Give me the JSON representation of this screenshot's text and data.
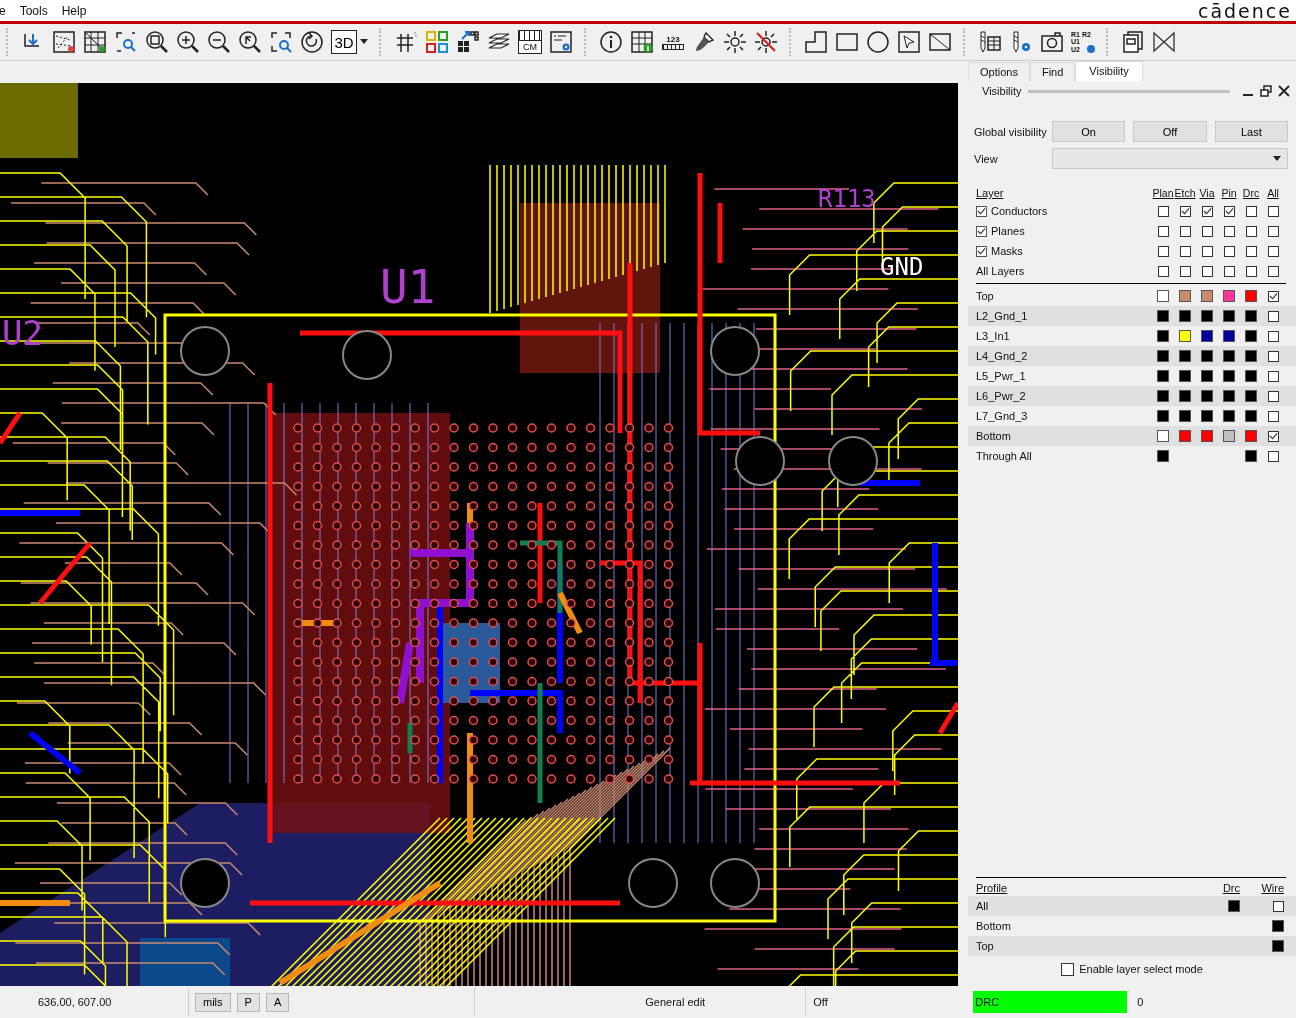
{
  "menu": [
    "e",
    "Tools",
    "Help"
  ],
  "logo": "cādence",
  "toolbar": {
    "button_3d": "3D",
    "cm_label": "CM",
    "ruler_label": "123",
    "refdes_lines": [
      "R1 R2",
      "U1",
      "U2"
    ]
  },
  "board_labels": [
    {
      "text": "U1",
      "kind": "ref"
    },
    {
      "text": "U2",
      "kind": "ref"
    },
    {
      "text": "R113",
      "kind": "ref"
    },
    {
      "text": "GND",
      "kind": "net"
    }
  ],
  "panel": {
    "tabs": [
      {
        "label": "Options",
        "selected": false
      },
      {
        "label": "Find",
        "selected": false
      },
      {
        "label": "Visibility",
        "selected": true
      }
    ],
    "title": "Visibility",
    "global_label": "Global visibility",
    "global_buttons": [
      "On",
      "Off",
      "Last"
    ],
    "view_label": "View",
    "layer_header": "Layer",
    "columns": [
      "Plan",
      "Etch",
      "Via",
      "Pin",
      "Drc",
      "All"
    ],
    "groups": [
      {
        "name": "Conductors",
        "kind": "check",
        "checked": true,
        "cells": [
          false,
          true,
          true,
          true,
          false,
          false
        ]
      },
      {
        "name": "Planes",
        "kind": "check",
        "checked": true,
        "cells": [
          false,
          false,
          false,
          false,
          false,
          false
        ]
      },
      {
        "name": "Masks",
        "kind": "check",
        "checked": true,
        "cells": [
          false,
          false,
          false,
          false,
          false,
          false
        ]
      },
      {
        "name": "All Layers",
        "kind": "plain",
        "cells": [
          false,
          false,
          false,
          false,
          false,
          false
        ]
      }
    ],
    "layers": [
      {
        "name": "Top",
        "swatches": [
          {
            "kind": "swatch",
            "color": "#ffffff"
          },
          {
            "kind": "swatch",
            "color": "#c8896e"
          },
          {
            "kind": "swatch",
            "color": "#c8896e"
          },
          {
            "kind": "swatch",
            "color": "#ff3399"
          },
          {
            "kind": "swatch",
            "color": "#ff0000"
          }
        ],
        "all": true
      },
      {
        "name": "L2_Gnd_1",
        "swatches": [
          {
            "kind": "swatch",
            "color": "#000000"
          },
          {
            "kind": "swatch",
            "color": "#000000"
          },
          {
            "kind": "swatch",
            "color": "#000000"
          },
          {
            "kind": "swatch",
            "color": "#000000"
          },
          {
            "kind": "swatch",
            "color": "#000000"
          }
        ],
        "all": false
      },
      {
        "name": "L3_In1",
        "swatches": [
          {
            "kind": "swatch",
            "color": "#000000"
          },
          {
            "kind": "swatch",
            "color": "#ffff00"
          },
          {
            "kind": "swatch",
            "color": "#000099"
          },
          {
            "kind": "swatch",
            "color": "#000099"
          },
          {
            "kind": "swatch",
            "color": "#000000"
          }
        ],
        "all": false
      },
      {
        "name": "L4_Gnd_2",
        "swatches": [
          {
            "kind": "swatch",
            "color": "#000000"
          },
          {
            "kind": "swatch",
            "color": "#000000"
          },
          {
            "kind": "swatch",
            "color": "#000000"
          },
          {
            "kind": "swatch",
            "color": "#000000"
          },
          {
            "kind": "swatch",
            "color": "#000000"
          }
        ],
        "all": false
      },
      {
        "name": "L5_Pwr_1",
        "swatches": [
          {
            "kind": "swatch",
            "color": "#000000"
          },
          {
            "kind": "swatch",
            "color": "#000000"
          },
          {
            "kind": "swatch",
            "color": "#000000"
          },
          {
            "kind": "swatch",
            "color": "#000000"
          },
          {
            "kind": "swatch",
            "color": "#000000"
          }
        ],
        "all": false
      },
      {
        "name": "L6_Pwr_2",
        "swatches": [
          {
            "kind": "swatch",
            "color": "#000000"
          },
          {
            "kind": "swatch",
            "color": "#000000"
          },
          {
            "kind": "swatch",
            "color": "#000000"
          },
          {
            "kind": "swatch",
            "color": "#000000"
          },
          {
            "kind": "swatch",
            "color": "#000000"
          }
        ],
        "all": false
      },
      {
        "name": "L7_Gnd_3",
        "swatches": [
          {
            "kind": "swatch",
            "color": "#000000"
          },
          {
            "kind": "swatch",
            "color": "#000000"
          },
          {
            "kind": "swatch",
            "color": "#000000"
          },
          {
            "kind": "swatch",
            "color": "#000000"
          },
          {
            "kind": "swatch",
            "color": "#000000"
          }
        ],
        "all": false
      },
      {
        "name": "Bottom",
        "swatches": [
          {
            "kind": "swatch",
            "color": "#ffffff"
          },
          {
            "kind": "swatch",
            "color": "#ff0000"
          },
          {
            "kind": "swatch",
            "color": "#ff0000"
          },
          {
            "kind": "swatch",
            "color": "#c0c0c0"
          },
          {
            "kind": "swatch",
            "color": "#ff0000"
          }
        ],
        "all": true
      },
      {
        "name": "Through All",
        "swatches": [
          {
            "kind": "swatch",
            "color": "#000000"
          },
          {
            "kind": "none"
          },
          {
            "kind": "none"
          },
          {
            "kind": "none"
          },
          {
            "kind": "swatch",
            "color": "#000000"
          }
        ],
        "all": false
      }
    ],
    "profile_header": "Profile",
    "profile_columns": [
      "Drc",
      "Wire"
    ],
    "profiles": [
      {
        "name": "All",
        "cells": [
          {
            "kind": "swatch",
            "color": "#000000"
          },
          {
            "kind": "checkbox",
            "checked": false
          }
        ]
      },
      {
        "name": "Bottom",
        "cells": [
          {
            "kind": "none"
          },
          {
            "kind": "swatch",
            "color": "#000000"
          }
        ]
      },
      {
        "name": "Top",
        "cells": [
          {
            "kind": "none"
          },
          {
            "kind": "swatch",
            "color": "#000000"
          }
        ]
      }
    ],
    "layer_select": {
      "label": "Enable layer select mode",
      "checked": false
    }
  },
  "status": {
    "coords": "636.00, 607.00",
    "units": "mils",
    "p": "P",
    "a": "A",
    "mode": "General edit",
    "state": "Off",
    "drc_label": "DRC",
    "drc_ok": true,
    "drc_count": "0"
  }
}
